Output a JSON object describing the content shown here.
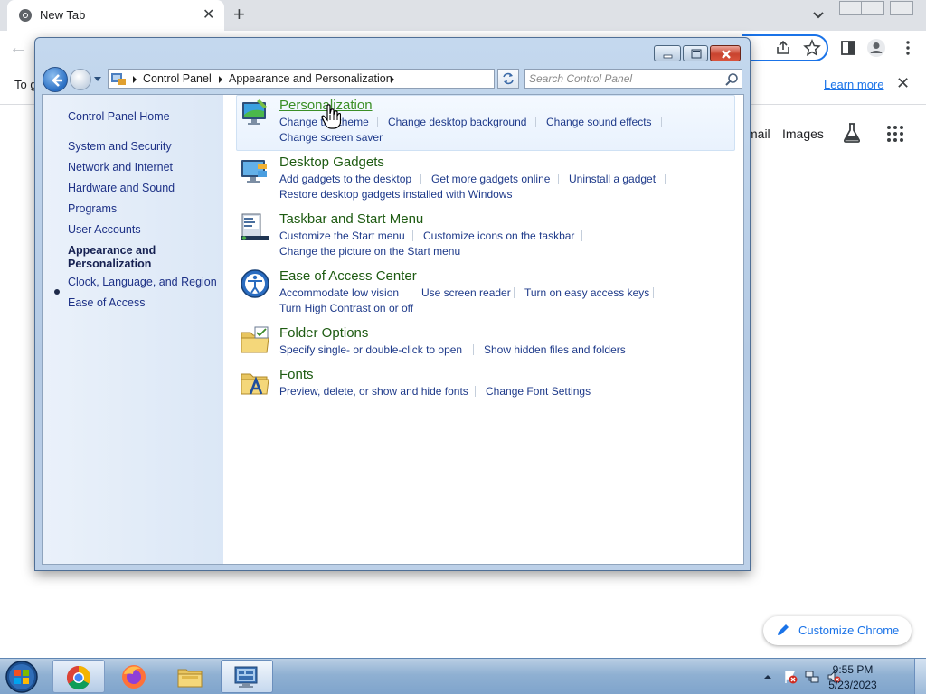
{
  "chrome": {
    "tab_title": "New Tab",
    "info_bar_text": "To g",
    "learn_more": "Learn more",
    "gmail": "mail",
    "images": "Images",
    "customize": "Customize Chrome"
  },
  "control_panel": {
    "breadcrumb": [
      "Control Panel",
      "Appearance and Personalization"
    ],
    "search_placeholder": "Search Control Panel",
    "sidebar": {
      "home": "Control Panel Home",
      "items": [
        "System and Security",
        "Network and Internet",
        "Hardware and Sound",
        "Programs",
        "User Accounts",
        "Appearance and",
        "Personalization",
        "Clock, Language, and Region",
        "Ease of Access"
      ]
    },
    "categories": [
      {
        "title": "Personalization",
        "icon": "personalization-icon",
        "links": [
          "Change the theme",
          "Change desktop background",
          "Change sound effects",
          "Change screen saver"
        ]
      },
      {
        "title": "Desktop Gadgets",
        "icon": "gadgets-icon",
        "links": [
          "Add gadgets to the desktop",
          "Get more gadgets online",
          "Uninstall a gadget",
          "Restore desktop gadgets installed with Windows"
        ]
      },
      {
        "title": "Taskbar and Start Menu",
        "icon": "taskbar-icon",
        "links": [
          "Customize the Start menu",
          "Customize icons on the taskbar",
          "Change the picture on the Start menu"
        ]
      },
      {
        "title": "Ease of Access Center",
        "icon": "ease-of-access-icon",
        "links": [
          "Accommodate low vision",
          "Use screen reader",
          "Turn on easy access keys",
          "Turn High Contrast on or off"
        ]
      },
      {
        "title": "Folder Options",
        "icon": "folder-options-icon",
        "links": [
          "Specify single- or double-click to open",
          "Show hidden files and folders"
        ]
      },
      {
        "title": "Fonts",
        "icon": "fonts-icon",
        "links": [
          "Preview, delete, or show and hide fonts",
          "Change Font Settings"
        ]
      }
    ]
  },
  "taskbar": {
    "time": "9:55 PM",
    "date": "5/23/2023",
    "apps": [
      "chrome-icon",
      "firefox-icon",
      "file-explorer-icon",
      "control-panel-icon"
    ]
  },
  "colors": {
    "link": "#1e3a8a",
    "category_title": "#1e5b12",
    "hover_title": "#3b8f27",
    "accent": "#1a73e8"
  }
}
